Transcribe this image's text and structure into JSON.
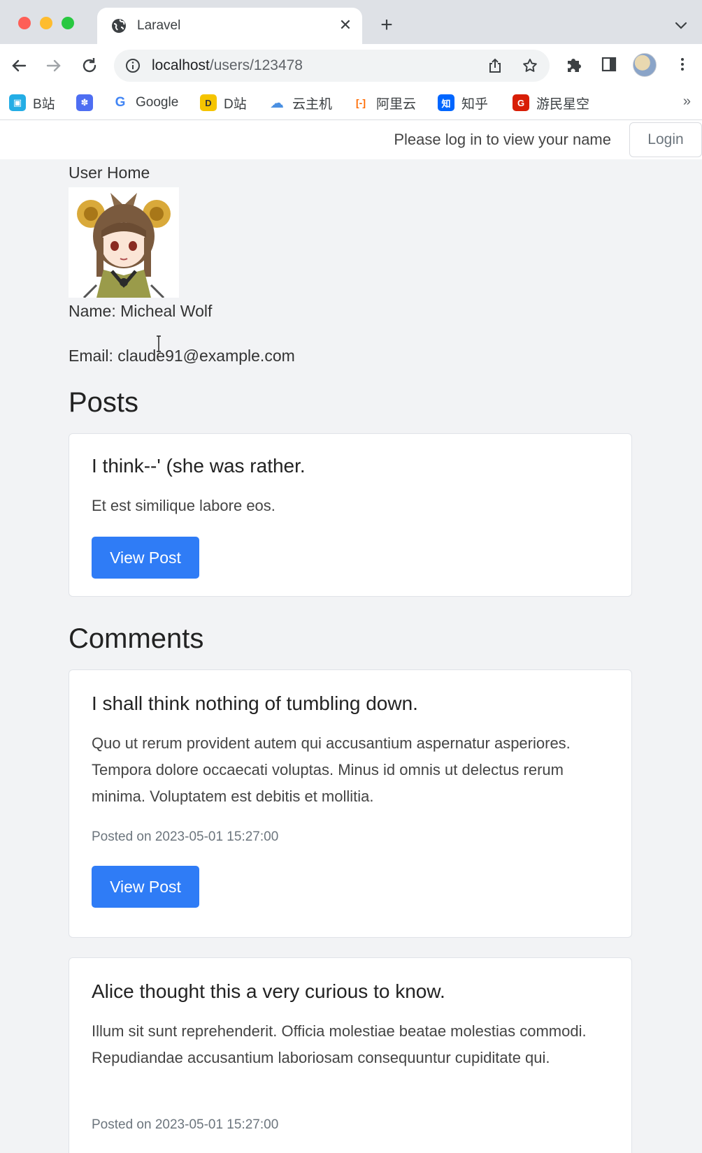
{
  "browser": {
    "tab_title": "Laravel",
    "url_host": "localhost",
    "url_path": "/users/123478",
    "bookmarks": [
      {
        "label": "B站",
        "icon": "bilibili-icon",
        "color": "#23ade5"
      },
      {
        "label": "",
        "icon": "baidu-paw-icon",
        "color": "#4e6ef2"
      },
      {
        "label": "Google",
        "icon": "google-icon",
        "color": "#4285f4"
      },
      {
        "label": "D站",
        "icon": "dilidili-icon",
        "color": "#f5c400"
      },
      {
        "label": "云主机",
        "icon": "cloud-icon",
        "color": "#4a90e2"
      },
      {
        "label": "阿里云",
        "icon": "aliyun-icon",
        "color": "#ff6a00"
      },
      {
        "label": "知乎",
        "icon": "zhihu-icon",
        "color": "#0066ff"
      },
      {
        "label": "游民星空",
        "icon": "gamersky-icon",
        "color": "#d81e06"
      }
    ],
    "bookmarks_more": "»"
  },
  "navbar": {
    "login_message": "Please log in to view your name",
    "login_button": "Login"
  },
  "user": {
    "heading": "User Home",
    "name_line": "Name: Micheal Wolf",
    "email_line": "Email: claude91@example.com"
  },
  "posts": {
    "heading": "Posts",
    "items": [
      {
        "title": "I think--' (she was rather.",
        "excerpt": "Et est similique labore eos.",
        "button": "View Post"
      }
    ]
  },
  "comments": {
    "heading": "Comments",
    "items": [
      {
        "title": "I shall think nothing of tumbling down.",
        "body": "Quo ut rerum provident autem qui accusantium aspernatur asperiores. Tempora dolore occaecati voluptas. Minus id omnis ut delectus rerum minima. Voluptatem est debitis et mollitia.",
        "posted": "Posted on 2023-05-01 15:27:00",
        "button": "View Post"
      },
      {
        "title": "Alice thought this a very curious to know.",
        "body": "Illum sit sunt reprehenderit. Officia molestiae beatae molestias commodi. Repudiandae accusantium laboriosam consequuntur cupiditate qui.",
        "posted": "Posted on 2023-05-01 15:27:00"
      }
    ]
  },
  "colors": {
    "primary": "#2f7cf6",
    "page_background": "#f2f3f5"
  }
}
